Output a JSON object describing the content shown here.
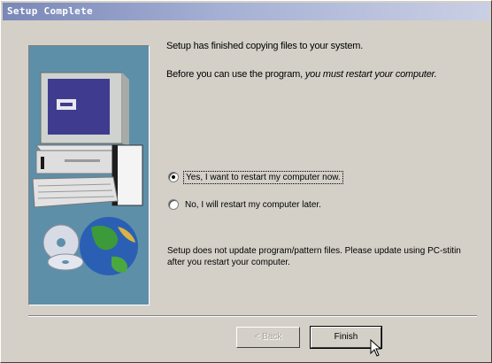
{
  "window": {
    "title": "Setup Complete"
  },
  "content": {
    "message_line1": "Setup has finished copying files to your system.",
    "message_line2_part1": "Before you can use the program, ",
    "message_line2_part2": "you must restart your computer.",
    "options": [
      {
        "label": "Yes, I want to restart my computer now.",
        "selected": true
      },
      {
        "label": "No, I will restart my computer later.",
        "selected": false
      }
    ],
    "note": "Setup does not update program/pattern files. Please update using PC-stitin after you restart your computer."
  },
  "buttons": {
    "back": "< Back",
    "finish": "Finish"
  },
  "colors": {
    "dialog_bg": "#d4d0c8",
    "art_panel_bg": "#5d8fa9",
    "titlebar_start": "#7a88b8"
  },
  "icons": {
    "illustration": "computer-and-cds-illustration",
    "cursor": "mouse-pointer-icon"
  }
}
